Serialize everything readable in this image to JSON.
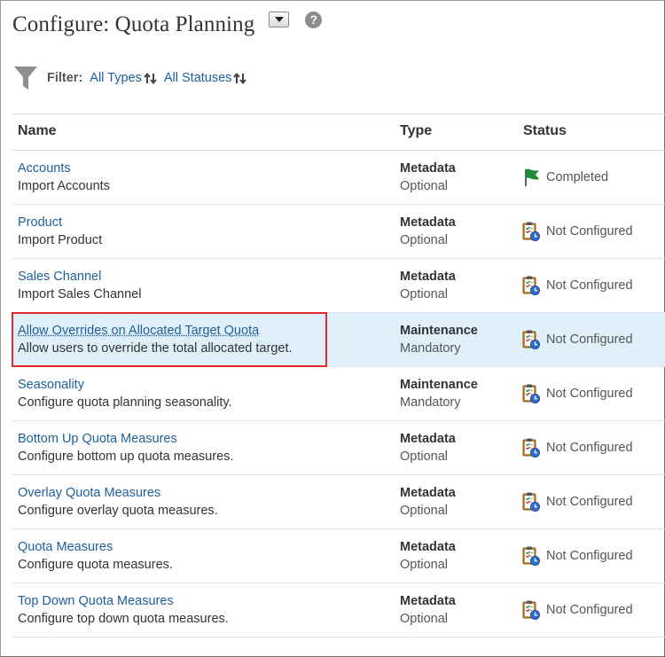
{
  "header": {
    "title": "Configure: Quota Planning",
    "help_glyph": "?"
  },
  "filter": {
    "label": "Filter:",
    "types_link": "All Types",
    "statuses_link": "All Statuses"
  },
  "table": {
    "columns": {
      "name": "Name",
      "type": "Type",
      "status": "Status"
    },
    "rows": [
      {
        "name": "Accounts",
        "description": "Import Accounts",
        "type": "Metadata",
        "requirement": "Optional",
        "status": "Completed",
        "status_icon": "green-flag-icon"
      },
      {
        "name": "Product",
        "description": "Import Product",
        "type": "Metadata",
        "requirement": "Optional",
        "status": "Not Configured",
        "status_icon": "clipboard-clock-icon"
      },
      {
        "name": "Sales Channel",
        "description": "Import Sales Channel",
        "type": "Metadata",
        "requirement": "Optional",
        "status": "Not Configured",
        "status_icon": "clipboard-clock-icon"
      },
      {
        "name": "Allow Overrides on Allocated Target Quota",
        "description": "Allow users to override the total allocated target.",
        "type": "Maintenance",
        "requirement": "Mandatory",
        "status": "Not Configured",
        "status_icon": "clipboard-clock-icon",
        "selected": true
      },
      {
        "name": "Seasonality",
        "description": "Configure quota planning seasonality.",
        "type": "Maintenance",
        "requirement": "Mandatory",
        "status": "Not Configured",
        "status_icon": "clipboard-clock-icon"
      },
      {
        "name": "Bottom Up Quota Measures",
        "description": "Configure bottom up quota measures.",
        "type": "Metadata",
        "requirement": "Optional",
        "status": "Not Configured",
        "status_icon": "clipboard-clock-icon"
      },
      {
        "name": "Overlay Quota Measures",
        "description": "Configure overlay quota measures.",
        "type": "Metadata",
        "requirement": "Optional",
        "status": "Not Configured",
        "status_icon": "clipboard-clock-icon"
      },
      {
        "name": "Quota Measures",
        "description": "Configure quota measures.",
        "type": "Metadata",
        "requirement": "Optional",
        "status": "Not Configured",
        "status_icon": "clipboard-clock-icon"
      },
      {
        "name": "Top Down Quota Measures",
        "description": "Configure top down quota measures.",
        "type": "Metadata",
        "requirement": "Optional",
        "status": "Not Configured",
        "status_icon": "clipboard-clock-icon"
      }
    ]
  },
  "colors": {
    "link": "#1f5f99",
    "selected_row": "#dff0fb",
    "highlight_border": "#e32b2b",
    "flag": "#1e8a3a"
  }
}
